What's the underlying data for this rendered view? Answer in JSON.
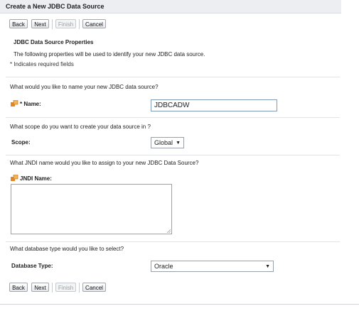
{
  "window": {
    "title": "Create a New JDBC Data Source"
  },
  "toolbar": {
    "back": "Back",
    "next": "Next",
    "finish": "Finish",
    "cancel": "Cancel"
  },
  "section": {
    "title": "JDBC Data Source Properties",
    "description": "The following properties will be used to identify your new JDBC data source.",
    "required_note": "* Indicates required fields"
  },
  "name": {
    "question": "What would you like to name your new JDBC data source?",
    "label": "* Name:",
    "value": "JDBCADW"
  },
  "scope": {
    "question": "What scope do you want to create your data source in ?",
    "label": "Scope:",
    "selected": "Global"
  },
  "jndi": {
    "question": "What JNDI name would you like to assign to your new JDBC Data Source?",
    "label": "JNDI Name:",
    "value": ""
  },
  "dbtype": {
    "question": "What database type would you like to select?",
    "label": "Database Type:",
    "selected": "Oracle"
  },
  "colors": {
    "title_bg": "#eceef1",
    "input_border": "#7f9db9",
    "icon_orange": "#e0892a"
  },
  "icons": {
    "field_help": "config-help-icon",
    "dropdown": "chevron-down-icon"
  }
}
